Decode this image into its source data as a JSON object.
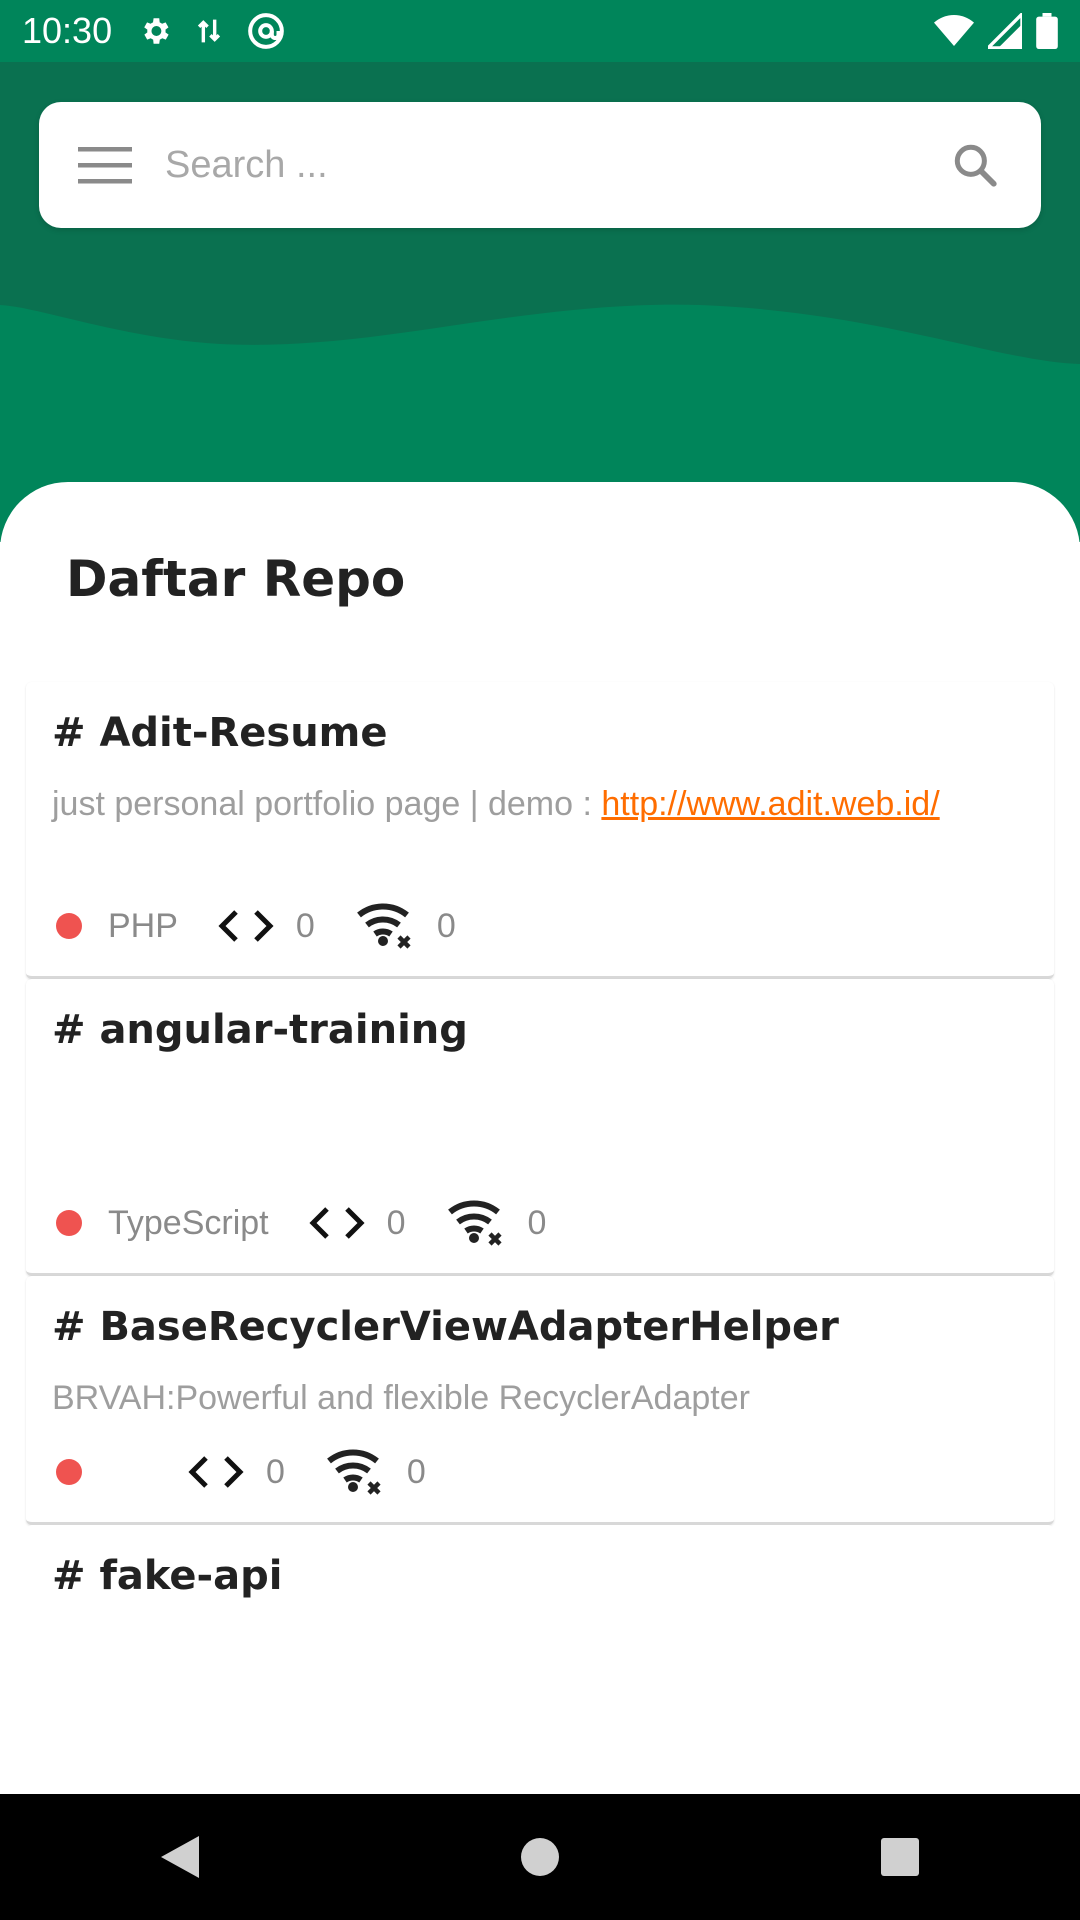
{
  "status_bar": {
    "time": "10:30",
    "icons": [
      "gear-icon",
      "data-transfer-icon",
      "at-sign-icon",
      "wifi-icon",
      "signal-icon",
      "battery-icon"
    ]
  },
  "search": {
    "placeholder": "Search ...",
    "value": ""
  },
  "section_title": "Daftar Repo",
  "repos": [
    {
      "name": "# Adit-Resume",
      "description_text": "just  personal portfolio page | demo : ",
      "description_link": "http://www.adit.web.id/",
      "language": "PHP",
      "forks": "0",
      "watchers": "0"
    },
    {
      "name": "# angular-training",
      "description_text": "",
      "language": "TypeScript",
      "forks": "0",
      "watchers": "0"
    },
    {
      "name": "# BaseRecyclerViewAdapterHelper",
      "description_text": "BRVAH:Powerful and flexible RecyclerAdapter",
      "language": "",
      "forks": "0",
      "watchers": "0"
    },
    {
      "name": "# fake-api"
    }
  ],
  "colors": {
    "primary": "#00855a",
    "primary_dark": "#0a7150",
    "lang_dot": "#ef5350",
    "link": "#ff6d00"
  }
}
